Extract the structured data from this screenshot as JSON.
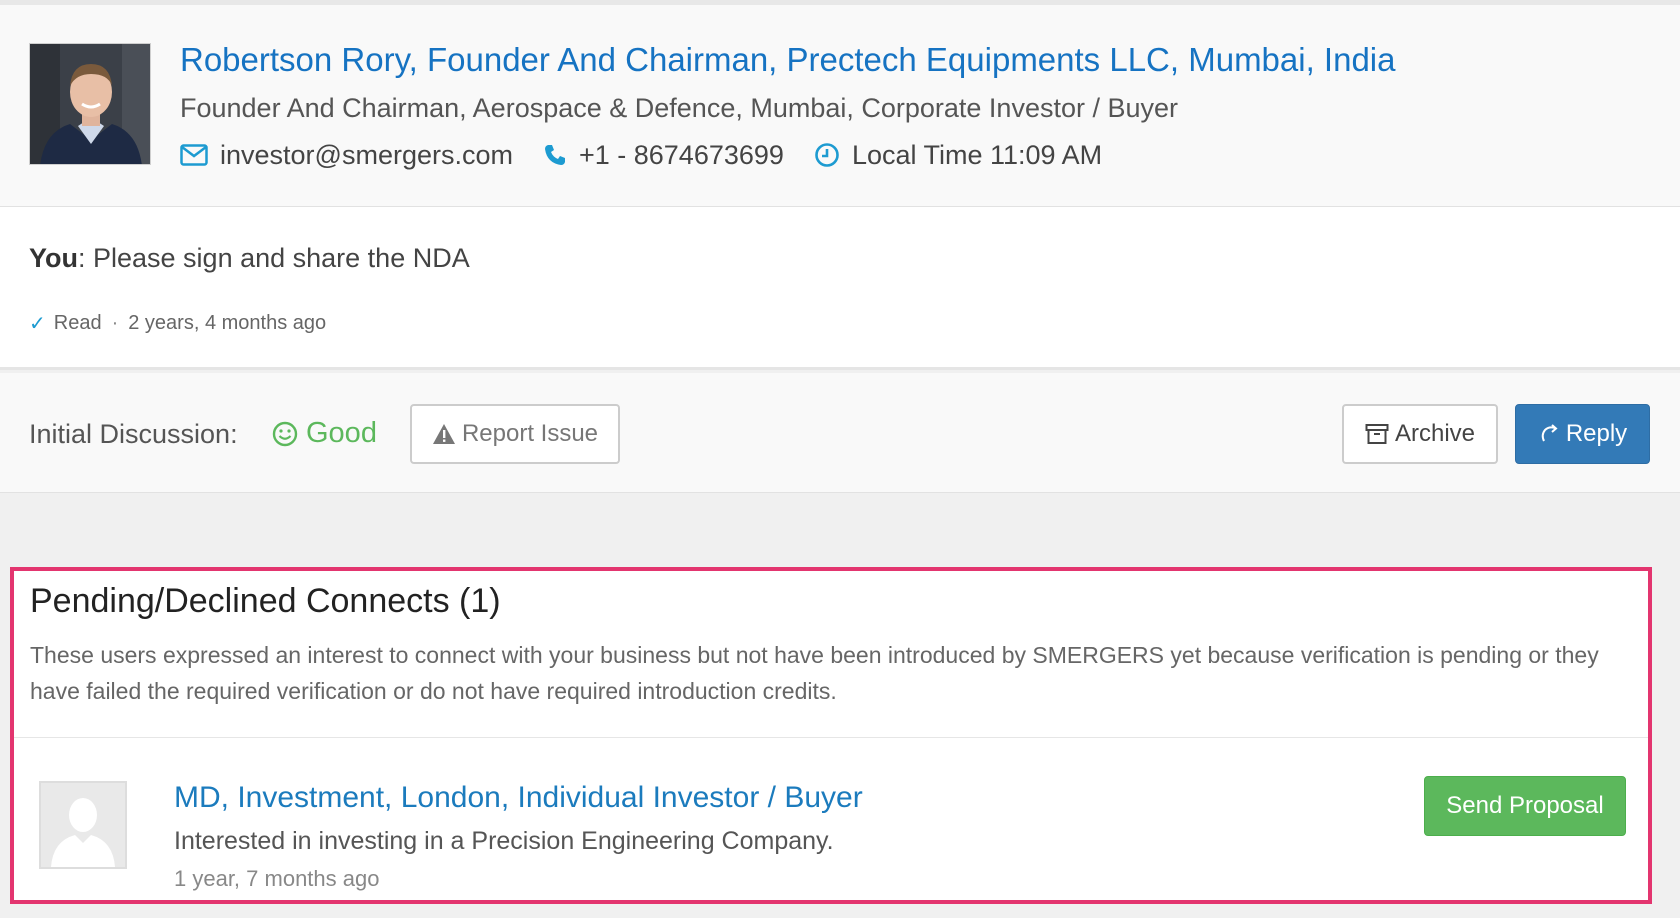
{
  "profile": {
    "title": "Robertson Rory, Founder And Chairman, Prectech Equipments LLC, Mumbai, India",
    "subtitle": "Founder And Chairman, Aerospace & Defence, Mumbai, Corporate Investor / Buyer",
    "email": "investor@smergers.com",
    "phone": "+1 - 8674673699",
    "local_time": "Local Time 11:09 AM"
  },
  "message": {
    "sender": "You",
    "text": ": Please sign and share the NDA",
    "status": "Read",
    "separator": "·",
    "time_ago": "2 years, 4 months ago"
  },
  "actions": {
    "discussion_label": "Initial Discussion:",
    "discussion_value": "Good",
    "report_label": "Report Issue",
    "archive_label": "Archive",
    "reply_label": "Reply"
  },
  "pending": {
    "title": "Pending/Declined Connects (1)",
    "description": "These users expressed an interest to connect with your business but not have been introduced by SMERGERS yet because verification is pending or they have failed the required verification or do not have required introduction credits.",
    "items": [
      {
        "name": "MD, Investment, London, Individual Investor / Buyer",
        "interest": "Interested in investing in a Precision Engineering Company.",
        "time_ago": "1 year, 7 months ago",
        "action_label": "Send Proposal"
      }
    ]
  },
  "colors": {
    "link_blue": "#1673c2",
    "good_green": "#5cb85c",
    "reply_blue": "#337ab7",
    "highlight_border": "#e3356f"
  },
  "icons": [
    "envelope-icon",
    "phone-icon",
    "clock-icon",
    "smile-icon",
    "warning-icon",
    "archive-icon",
    "reply-icon",
    "check-icon",
    "user-placeholder-icon"
  ]
}
